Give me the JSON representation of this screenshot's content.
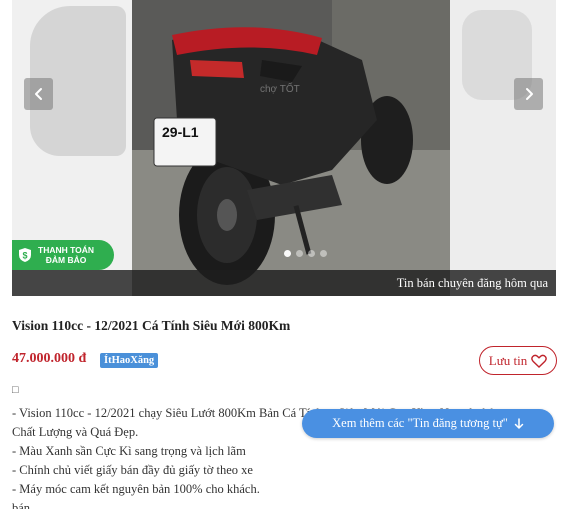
{
  "gallery": {
    "watermark": "chợ TỐT",
    "plate_text": "29-L1",
    "badge": {
      "line1": "THANH TOÁN",
      "line2": "ĐẢM BẢO"
    },
    "caption": "Tin bán chuyên đăng hôm qua",
    "prev_icon": "chevron-left-icon",
    "next_icon": "chevron-right-icon",
    "dots_total": 4,
    "dot_active": 1
  },
  "listing": {
    "title": "Vision 110cc - 12/2021 Cá Tính Siêu Mới 800Km",
    "price": "47.000.000 đ",
    "tag": "ÍtHaoXăng",
    "save_label": "Lưu tin",
    "glyph": "□",
    "description": [
      "- Vision 110cc - 12/2021 chạy Siêu Lướt 800Km Bản Cá Tính ... Siêu Mới Cực Kì ... Nguyên bản,",
      "Chất Lượng và Quá Đẹp.",
      "- Màu Xanh sần Cực Kì sang trọng và lịch lãm",
      "- Chính chủ viết giấy bán đầy đủ giấy tờ theo xe",
      "- Máy móc cam kết nguyên bản 100% cho khách.",
      "bán"
    ],
    "more_button": "Xem thêm các \"Tin đăng tương tự\""
  },
  "colors": {
    "price": "#c0242c",
    "tag_bg": "#4a90d9",
    "badge_bg": "#2fae4f",
    "more_btn_bg": "#4a90e2"
  }
}
